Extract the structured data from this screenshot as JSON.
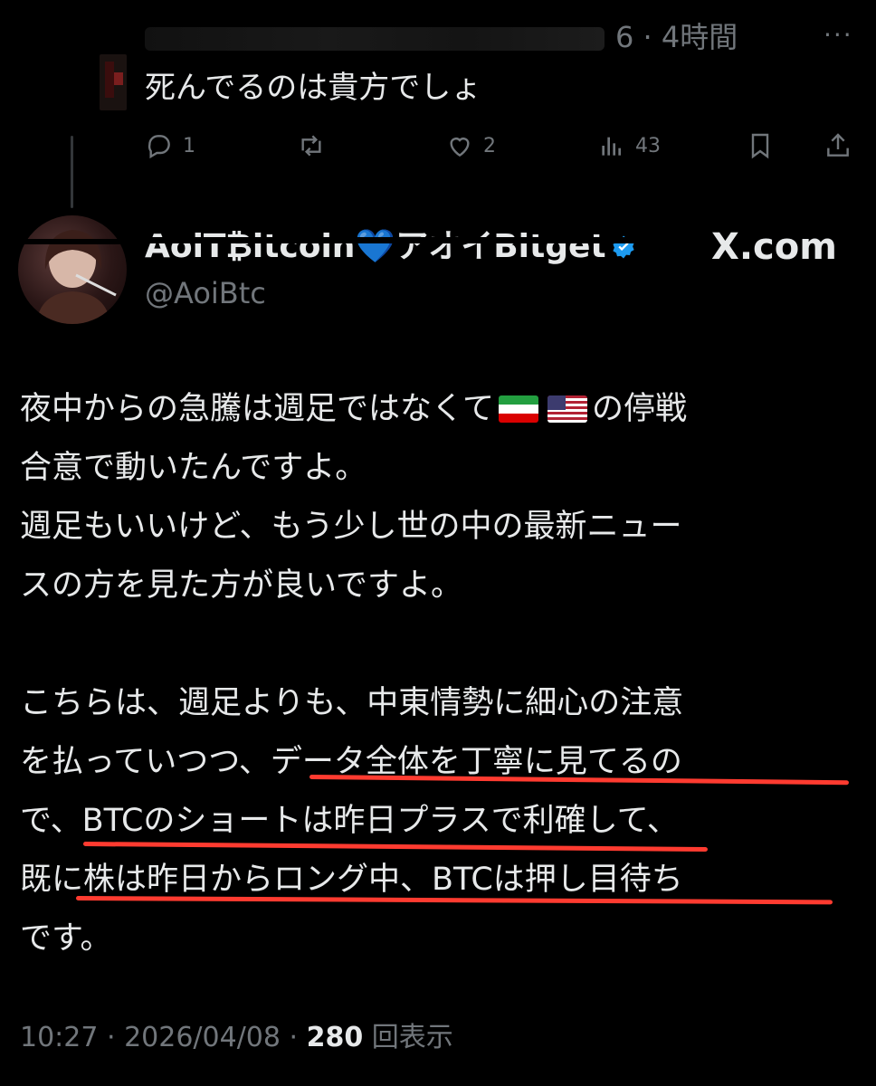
{
  "reply": {
    "time": "6 · 4時間",
    "text": "死んでるのは貴方でしょ",
    "actions": {
      "replies": "1",
      "reposts": "",
      "likes": "2",
      "views": "43"
    }
  },
  "tweet": {
    "display_name": "AoiT₿itcoin💙アオイBitget",
    "handle": "@AoiBtc",
    "source_label": "X.com",
    "body": {
      "l1_a": "夜中からの急騰は週足ではなくて",
      "l1_b": "の停戦",
      "l2": "合意で動いたんですよ。",
      "l3": "週足もいいけど、もう少し世の中の最新ニュー",
      "l4": "スの方を見た方が良いですよ。",
      "l5": "こちらは、週足よりも、中東情勢に細心の注意",
      "l6": "を払っていつつ、データ全体を丁寧に見てるの",
      "l7": "で、BTCのショートは昨日プラスで利確して、",
      "l8": "既に株は昨日からロング中、BTCは押し目待ち",
      "l9": "です。"
    },
    "time": "10:27 · 2026/04/08 · ",
    "views_count": "280",
    "views_label": "回表示"
  },
  "colors": {
    "background": "#000000",
    "text": "#e7e9ea",
    "muted": "#71767b",
    "accent": "#1d9bf0",
    "annotation": "#ff3b30"
  },
  "icons": [
    "reply-icon",
    "repost-icon",
    "like-icon",
    "views-icon",
    "bookmark-icon",
    "share-icon",
    "more-icon",
    "verified-badge-icon"
  ]
}
